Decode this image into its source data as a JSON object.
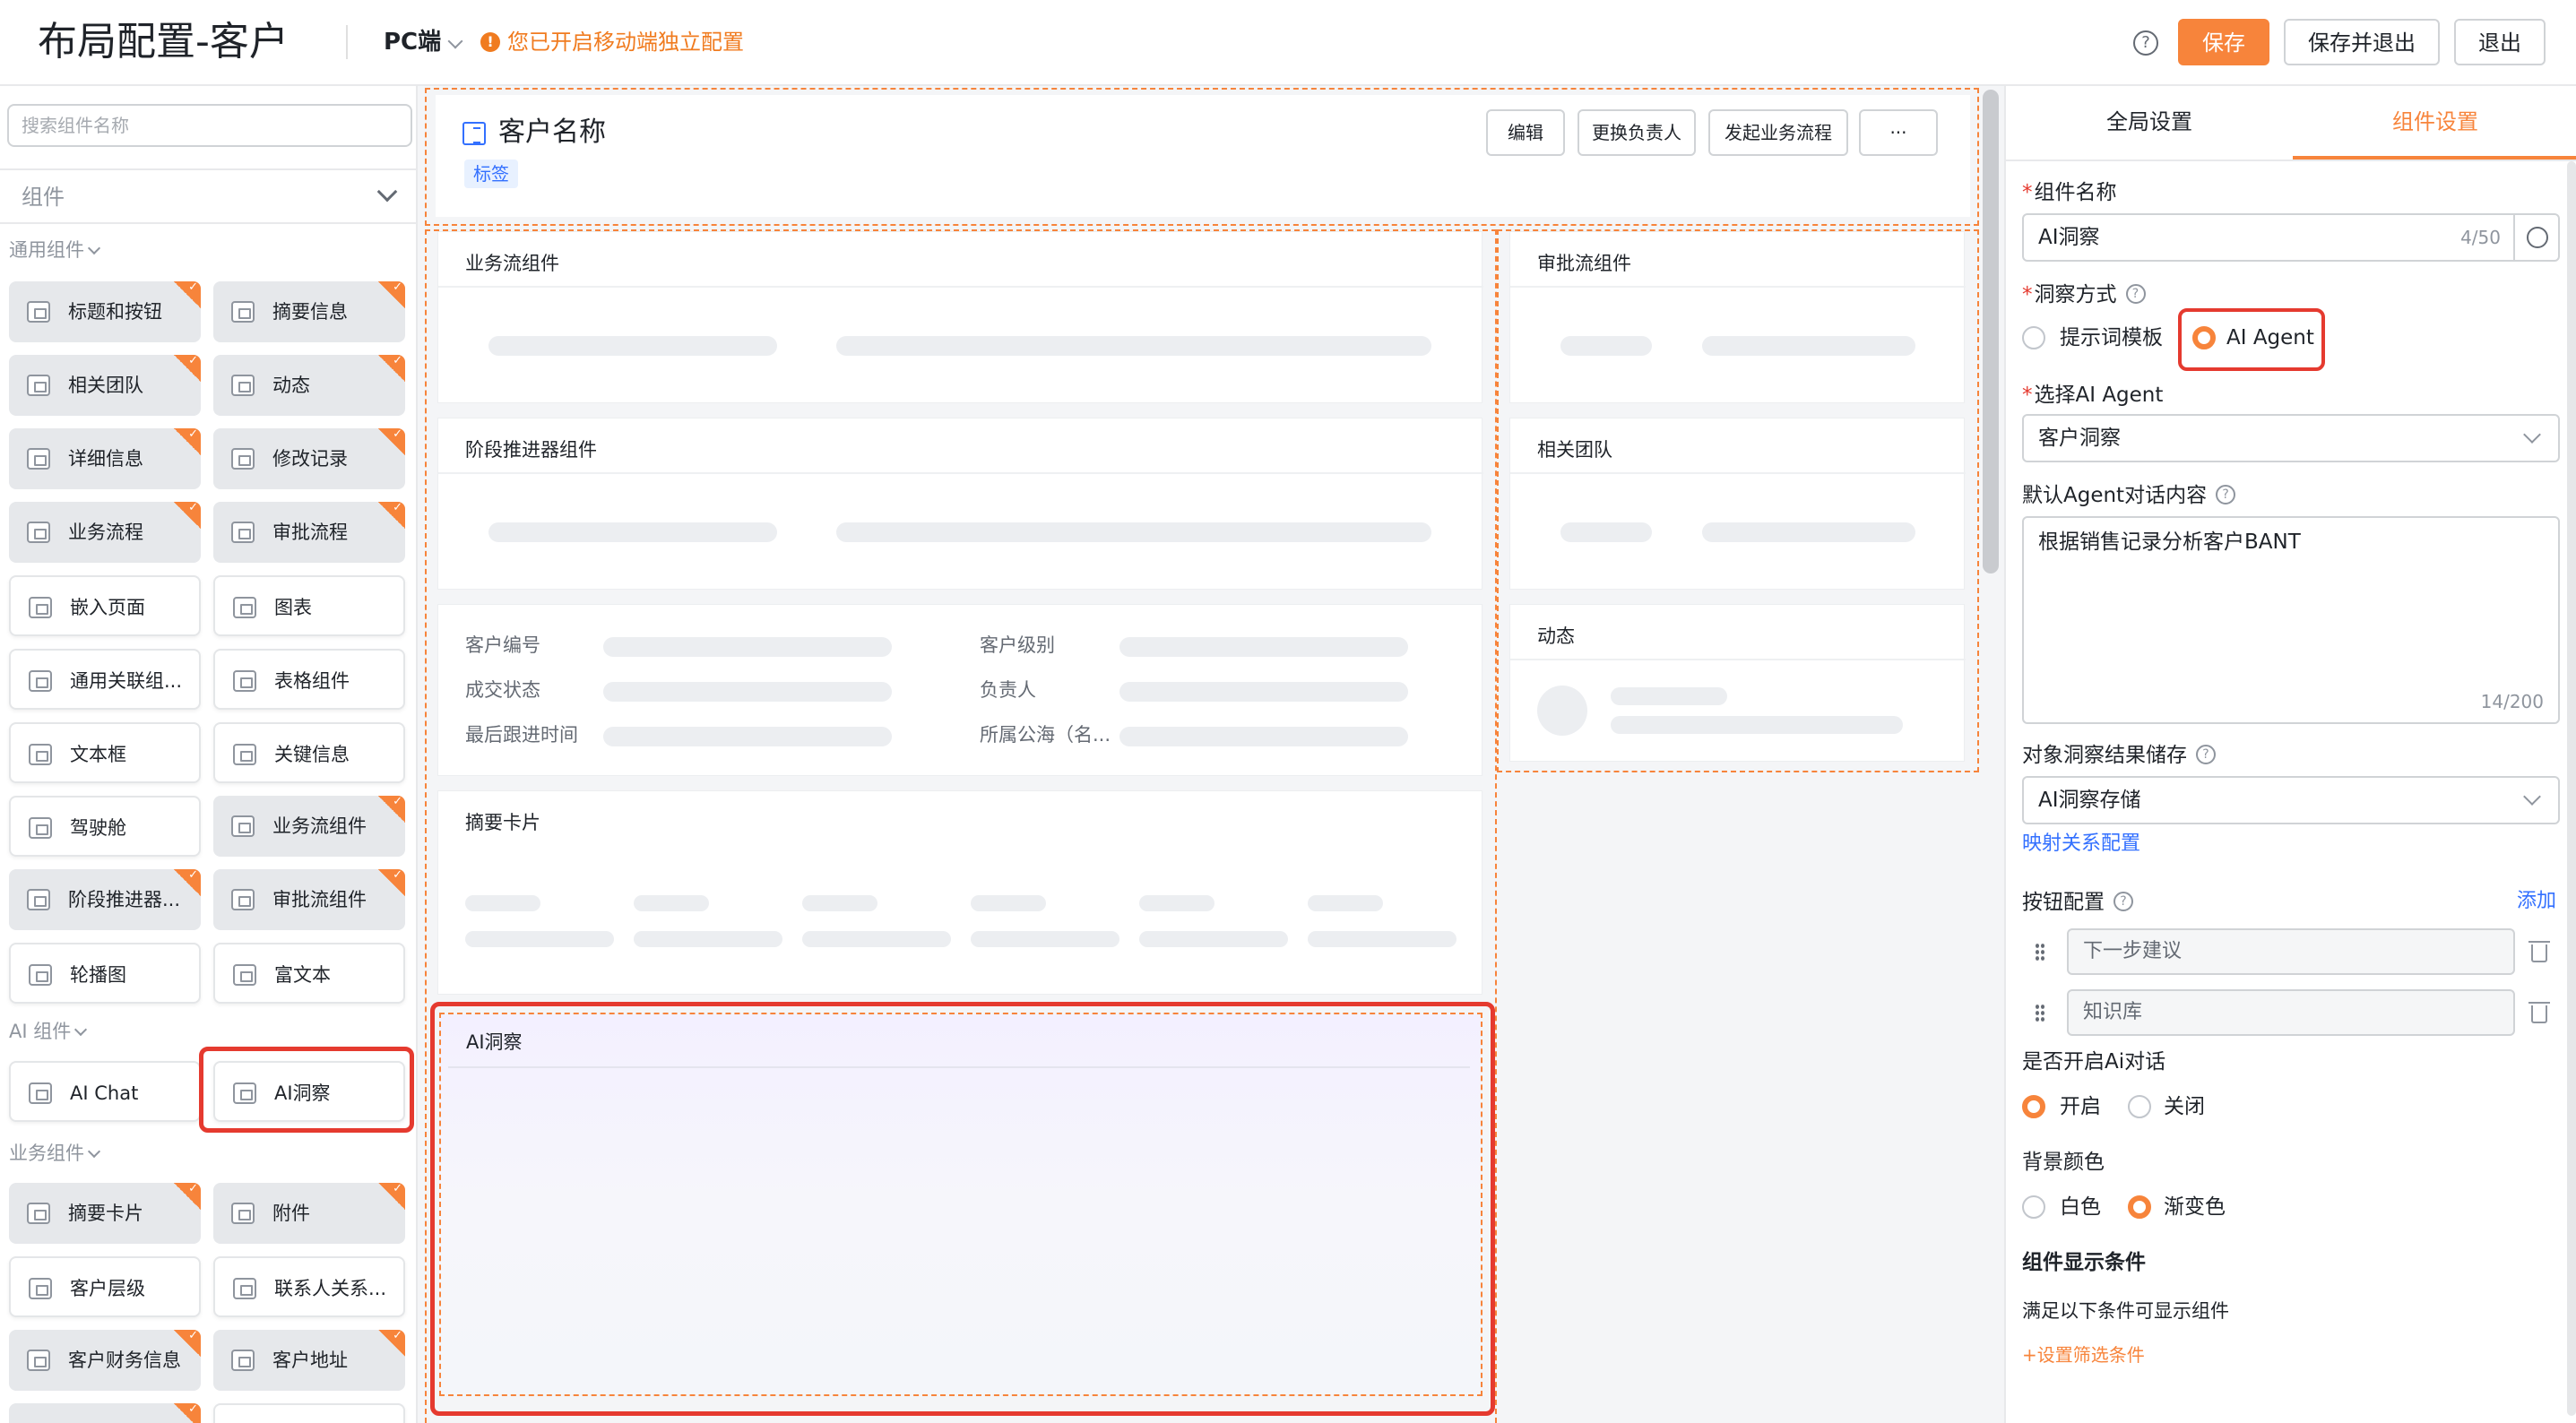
{
  "top": {
    "title": "布局配置-客户",
    "device": "PC端",
    "notice": "您已开启移动端独立配置",
    "notice_icon": "!",
    "help": "?",
    "save": "保存",
    "save_exit": "保存并退出",
    "exit": "退出"
  },
  "sidebar": {
    "search_placeholder": "搜索组件名称",
    "group": "组件",
    "sec_general": "通用组件",
    "sec_ai": "AI 组件",
    "sec_business": "业务组件",
    "general": [
      "标题和按钮",
      "摘要信息",
      "相关团队",
      "动态",
      "详细信息",
      "修改记录",
      "业务流程",
      "审批流程",
      "嵌入页面",
      "图表",
      "通用关联组...",
      "表格组件",
      "文本框",
      "关键信息",
      "驾驶舱",
      "业务流组件",
      "阶段推进器...",
      "审批流组件",
      "轮播图",
      "富文本"
    ],
    "ai": [
      "AI Chat",
      "AI洞察"
    ],
    "business": [
      "摘要卡片",
      "附件",
      "客户层级",
      "联系人关系...",
      "客户财务信息",
      "客户地址"
    ]
  },
  "canvas": {
    "header_title": "客户名称",
    "tag": "标签",
    "btn_edit": "编辑",
    "btn_owner": "更换负责人",
    "btn_flow": "发起业务流程",
    "btn_more": "···",
    "card_bizflow": "业务流组件",
    "card_stage": "阶段推进器组件",
    "fields": [
      "客户编号",
      "客户级别",
      "成交状态",
      "负责人",
      "最后跟进时间",
      "所属公海（名..."
    ],
    "card_summary": "摘要卡片",
    "card_ai": "AI洞察",
    "card_approval": "审批流组件",
    "card_team": "相关团队",
    "card_dynamic": "动态"
  },
  "panel": {
    "tab_global": "全局设置",
    "tab_component": "组件设置",
    "name_label": "组件名称",
    "name_value": "AI洞察",
    "name_count": "4/50",
    "method_label": "洞察方式",
    "method_opt1": "提示词模板",
    "method_opt2": "AI Agent",
    "agent_label": "选择AI Agent",
    "agent_value": "客户洞察",
    "default_label": "默认Agent对话内容",
    "default_value": "根据销售记录分析客户BANT",
    "default_count": "14/200",
    "store_label": "对象洞察结果储存",
    "store_value": "AI洞察存储",
    "mapping_link": "映射关系配置",
    "btn_cfg_label": "按钮配置",
    "add_link": "添加",
    "btn_item1": "下一步建议",
    "btn_item2": "知识库",
    "chat_label": "是否开启Ai对话",
    "chat_on": "开启",
    "chat_off": "关闭",
    "bg_label": "背景颜色",
    "bg_white": "白色",
    "bg_gradient": "渐变色",
    "cond_label": "组件显示条件",
    "cond_desc": "满足以下条件可显示组件",
    "cond_link": "+设置筛选条件"
  },
  "colors": {
    "accent": "#f7843b",
    "highlight": "#e53a2f",
    "link": "#3370ff"
  }
}
